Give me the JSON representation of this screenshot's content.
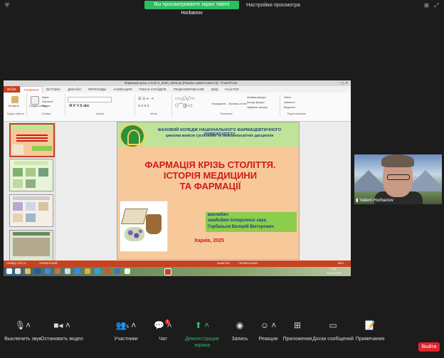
{
  "top": {
    "banner": "Вы просматриваете экран Valerii Horbanov",
    "view_options": "Настройки просмотра"
  },
  "powerpoint": {
    "title": "Фармація крізь століття_2020_2025.pp [Режим совместимости] - PowerPoint",
    "tabs": [
      "ФАЙЛ",
      "ГЛАВНАЯ",
      "ВСТАВКА",
      "ДИЗАЙН",
      "ПЕРЕХОДЫ",
      "АНИМАЦИЯ",
      "ПОКАЗ СЛАЙДОВ",
      "РЕЦЕНЗИРОВАНИЕ",
      "ВИД",
      "Foxit PDF"
    ],
    "ribbon": {
      "clipboard": "Буфер обмена",
      "slides": "Слайды",
      "font": "Шрифт",
      "paragraph": "Абзац",
      "drawing": "Рисование",
      "editing": "Редактирование",
      "paste": "Вставить",
      "create_slide": "Создать слайд",
      "layout": "Макет",
      "reset": "Сбросить",
      "section": "Раздел",
      "arrange": "Упорядочить",
      "quick_styles": "Экспресс-стили",
      "fill": "Заливка фигуры",
      "outline": "Контур фигуры",
      "effects": "Эффекты фигуры",
      "find": "Найти",
      "replace": "Заменить",
      "select": "Выделить"
    },
    "slide": {
      "college": "ФАХОВИЙ КОЛЕДЖ НАЦІОНАЛЬНОГО ФАРМАЦЕВТИЧНОГО УНІВЕРСИТЕТУ",
      "commission": "циклова комісія суспільних та загальноосвітніх дисциплін",
      "title_line1": "ФАРМАЦІЯ КРІЗЬ СТОЛІТТЯ.",
      "title_line2": "ІСТОРІЯ МЕДИЦИНИ",
      "title_line3": "ТА ФАРМАЦІЇ",
      "lecturer_label": "викладач:",
      "lecturer_degree": "кандидат історичних наук,",
      "lecturer_name": "Горбаньов Валерій Вікторович",
      "city_year": "Харків, 2025"
    },
    "status": {
      "slide_info": "СЛАЙД 1 ИЗ 19",
      "language": "УКРАИНСКИЙ",
      "notes": "ЗАМЕТКИ",
      "comments": "ПРИМЕЧАНИЯ",
      "zoom": "66%"
    },
    "taskbar_time": "9:32",
    "taskbar_date": "25.02.2025"
  },
  "participant": {
    "name": "Valerii Horbanov"
  },
  "meeting_toolbar": {
    "mute": "Выключить звук",
    "video": "Остановить видео",
    "participants": "Участники",
    "participants_count": "5",
    "chat": "Чат",
    "share": "Демонстрация экрана",
    "record": "Запись",
    "reactions": "Реакции",
    "apps": "Приложения",
    "whiteboards": "Доски сообщений",
    "notes": "Примечания",
    "exit": "Выйти"
  },
  "colors": {
    "ppt_accent": "#c9411e",
    "share_green": "#2dbe60",
    "exit_red": "#e0252b"
  }
}
